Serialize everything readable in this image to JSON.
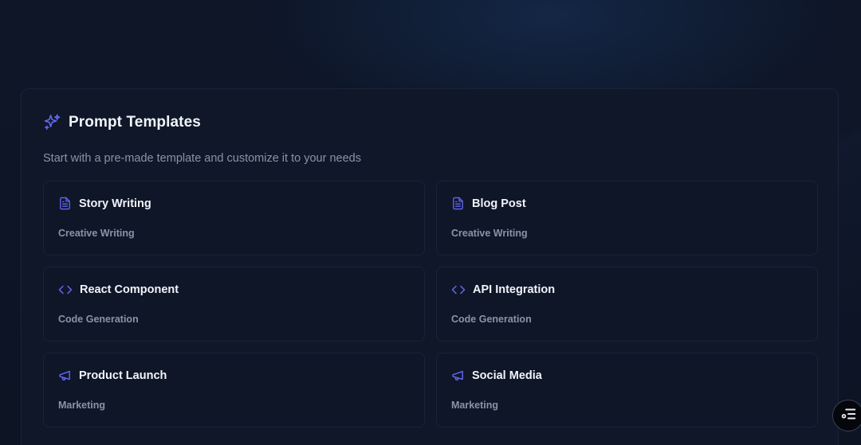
{
  "panel": {
    "title": "Prompt Templates",
    "title_icon": "sparkles-icon",
    "subtitle": "Start with a pre-made template and customize it to your needs"
  },
  "templates": [
    {
      "title": "Story Writing",
      "category": "Creative Writing",
      "icon": "document-icon"
    },
    {
      "title": "Blog Post",
      "category": "Creative Writing",
      "icon": "document-icon"
    },
    {
      "title": "React Component",
      "category": "Code Generation",
      "icon": "code-icon"
    },
    {
      "title": "API Integration",
      "category": "Code Generation",
      "icon": "code-icon"
    },
    {
      "title": "Product Launch",
      "category": "Marketing",
      "icon": "megaphone-icon"
    },
    {
      "title": "Social Media",
      "category": "Marketing",
      "icon": "megaphone-icon"
    }
  ],
  "colors": {
    "accent": "#6366f1",
    "background": "#0d1424",
    "panel": "#0f1729",
    "text_primary": "#f1f4f9",
    "text_secondary": "#8a93a6"
  },
  "floating_button": {
    "icon": "menu-settings-icon"
  }
}
